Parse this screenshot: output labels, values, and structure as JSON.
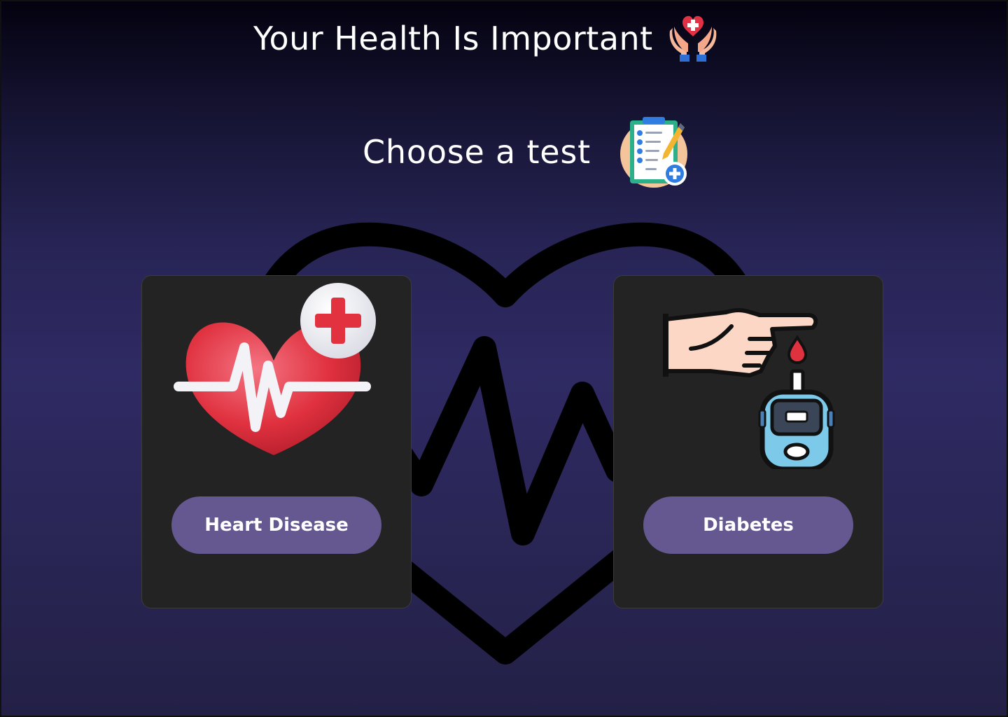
{
  "header": {
    "title": "Your Health Is Important",
    "title_icon": "caring-hands-heart-icon"
  },
  "subheader": {
    "title": "Choose a test",
    "icon": "medical-clipboard-checklist-icon"
  },
  "background": {
    "decoration": "heart-pulse-outline"
  },
  "cards": [
    {
      "illustration": "heart-pulse-plus-icon",
      "button_label": "Heart Disease"
    },
    {
      "illustration": "glucose-meter-finger-prick-icon",
      "button_label": "Diabetes"
    }
  ],
  "colors": {
    "card_background": "#232323",
    "button_background": "#65578f",
    "text": "#ffffff"
  }
}
